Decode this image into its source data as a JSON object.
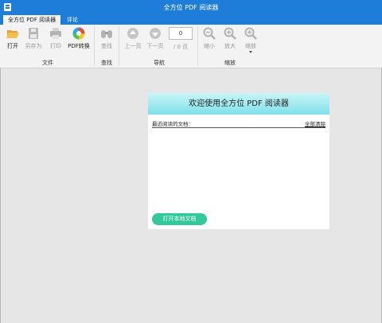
{
  "title": "全方位 PDF 阅读器",
  "tabs": [
    "全方位 PDF 阅读器",
    "评论"
  ],
  "tools": {
    "open": "打开",
    "save_as": "另存为",
    "print": "打印",
    "pdf_convert": "PDF转换",
    "find": "查找",
    "prev_page": "上一页",
    "next_page": "下一页",
    "zoom_out": "缩小",
    "zoom_in": "放大",
    "zoom": "缩放"
  },
  "groups": {
    "file": "文件",
    "find": "查找",
    "navigate": "导航",
    "zoom": "缩放"
  },
  "navigation": {
    "page_value": "0",
    "page_total": "/ 0 页"
  },
  "welcome": {
    "header": "欢迎使用全方位 PDF 阅读器",
    "recent_label": "最近阅读的文档：",
    "clear_all": "全部清除",
    "open_local_button": "打开本地文档"
  },
  "colors": {
    "titlebar": "#1e7dd8",
    "open_button": "#33c99a",
    "welcome_header_top": "#c8f5f7",
    "welcome_header_bottom": "#7fe0ea"
  }
}
